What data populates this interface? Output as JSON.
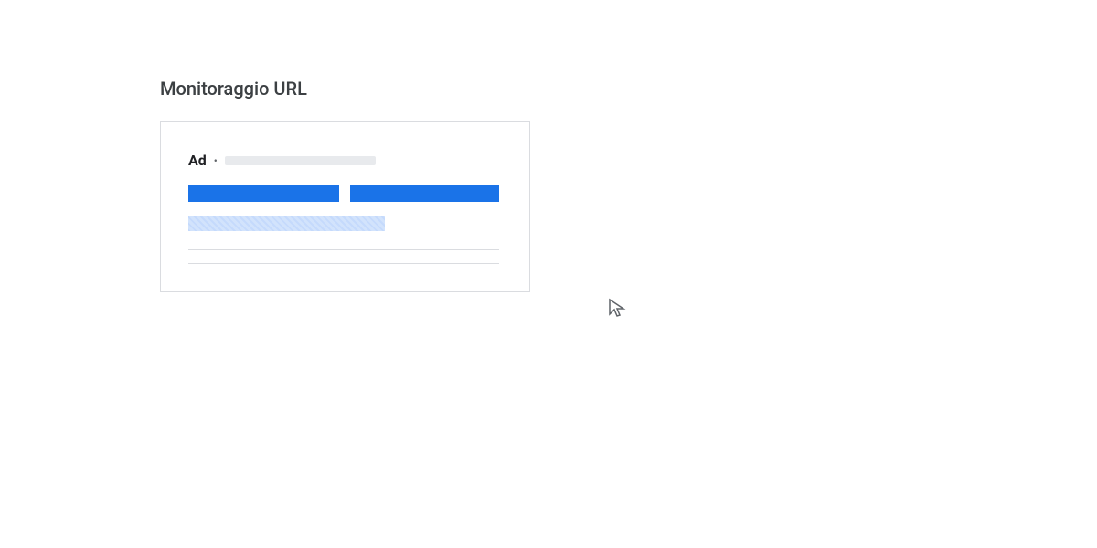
{
  "title": "Monitoraggio URL",
  "ad": {
    "label": "Ad",
    "separator": "•"
  },
  "colors": {
    "blue": "#1a73e8",
    "light_blue": "#d2e3fc",
    "gray": "#e8eaed",
    "border": "#dadce0",
    "text_dark": "#202124",
    "text_medium": "#3c4043"
  }
}
